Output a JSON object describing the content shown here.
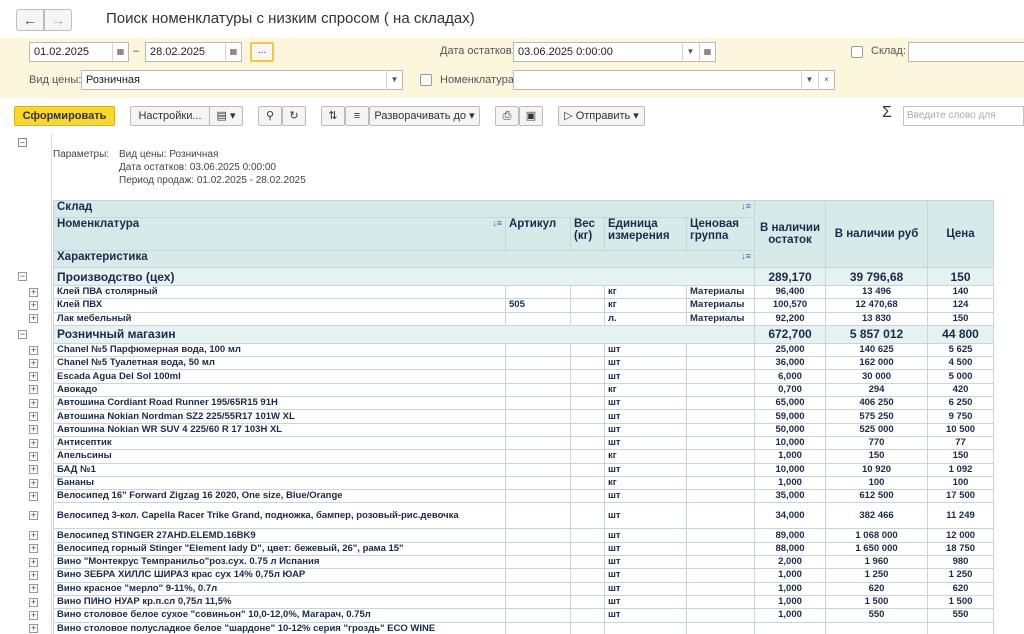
{
  "window": {
    "title": "Поиск номенклатуры с низким спросом ( на складах)"
  },
  "filters": {
    "date_from": "01.02.2025",
    "date_to": "28.02.2025",
    "dash": "–",
    "dots": "...",
    "stock_date_label": "Дата остатков:",
    "stock_date_value": "03.06.2025  0:00:00",
    "warehouse_label": "Склад:",
    "price_type_label": "Вид цены:",
    "price_type_value": "Розничная",
    "nomenclature_label": "Номенклатура:"
  },
  "toolbar": {
    "generate": "Сформировать",
    "settings": "Настройки...",
    "expand": "Разворачивать до",
    "send": "Отправить",
    "sigma": "Σ",
    "search_placeholder": "Введите слово для"
  },
  "params": {
    "label": "Параметры:",
    "line1": "Вид цены: Розничная",
    "line2": "Дата остатков: 03.06.2025 0:00:00",
    "line3": "Период продаж: 01.02.2025 - 28.02.2025"
  },
  "table": {
    "headers": {
      "warehouse": "Склад",
      "nomenclature": "Номенклатура",
      "article": "Артикул",
      "weight": "Вес (кг)",
      "unit": "Единица измерения",
      "price_group": "Ценовая группа",
      "stock_qty": "В наличии остаток",
      "stock_rub": "В наличии руб",
      "price": "Цена",
      "characteristic": "Характеристика"
    },
    "groups": [
      {
        "name": "Производство (цех)",
        "qty": "289,170",
        "rub": "39 796,68",
        "price": "150",
        "rows": [
          {
            "name": "Клей ПВА столярный",
            "article": "",
            "unit": "кг",
            "group": "Материалы",
            "qty": "96,400",
            "rub": "13 496",
            "price": "140"
          },
          {
            "name": "Клей ПВХ",
            "article": "505",
            "unit": "кг",
            "group": "Материалы",
            "qty": "100,570",
            "rub": "12 470,68",
            "price": "124"
          },
          {
            "name": "Лак мебельный",
            "article": "",
            "unit": "л.",
            "group": "Материалы",
            "qty": "92,200",
            "rub": "13 830",
            "price": "150"
          }
        ]
      },
      {
        "name": "Розничный магазин",
        "qty": "672,700",
        "rub": "5 857 012",
        "price": "44 800",
        "rows": [
          {
            "name": "Chanel №5 Парфюмерная вода, 100 мл",
            "article": "",
            "unit": "шт",
            "group": "",
            "qty": "25,000",
            "rub": "140 625",
            "price": "5 625"
          },
          {
            "name": "Chanel №5 Туалетная вода, 50 мл",
            "article": "",
            "unit": "шт",
            "group": "",
            "qty": "36,000",
            "rub": "162 000",
            "price": "4 500"
          },
          {
            "name": "Escada Agua Del Sol 100ml",
            "article": "",
            "unit": "шт",
            "group": "",
            "qty": "6,000",
            "rub": "30 000",
            "price": "5 000"
          },
          {
            "name": "Авокадо",
            "article": "",
            "unit": "кг",
            "group": "",
            "qty": "0,700",
            "rub": "294",
            "price": "420"
          },
          {
            "name": "Автошина Cordiant Road Runner 195/65R15 91H",
            "article": "",
            "unit": "шт",
            "group": "",
            "qty": "65,000",
            "rub": "406 250",
            "price": "6 250"
          },
          {
            "name": "Автошина Nokian Nordman SZ2 225/55R17 101W XL",
            "article": "",
            "unit": "шт",
            "group": "",
            "qty": "59,000",
            "rub": "575 250",
            "price": "9 750"
          },
          {
            "name": "Автошина Nokian WR SUV 4 225/60 R 17 103H XL",
            "article": "",
            "unit": "шт",
            "group": "",
            "qty": "50,000",
            "rub": "525 000",
            "price": "10 500"
          },
          {
            "name": "Антисептик",
            "article": "",
            "unit": "шт",
            "group": "",
            "qty": "10,000",
            "rub": "770",
            "price": "77"
          },
          {
            "name": "Апельсины",
            "article": "",
            "unit": "кг",
            "group": "",
            "qty": "1,000",
            "rub": "150",
            "price": "150"
          },
          {
            "name": "БАД №1",
            "article": "",
            "unit": "шт",
            "group": "",
            "qty": "10,000",
            "rub": "10 920",
            "price": "1 092"
          },
          {
            "name": "Бананы",
            "article": "",
            "unit": "кг",
            "group": "",
            "qty": "1,000",
            "rub": "100",
            "price": "100"
          },
          {
            "name": "Велосипед 16\" Forward Zigzag 16 2020, One size, Blue/Orange",
            "article": "",
            "unit": "шт",
            "group": "",
            "qty": "35,000",
            "rub": "612 500",
            "price": "17 500"
          },
          {
            "name": "Велосипед 3-кол. Capella Racer Trike Grand, подножка, бампер, розовый-рис.девочка",
            "article": "",
            "unit": "шт",
            "group": "",
            "qty": "34,000",
            "rub": "382 466",
            "price": "11 249",
            "tall": true
          },
          {
            "name": "Велосипед STINGER 27AHD.ELEMD.16BK9",
            "article": "",
            "unit": "шт",
            "group": "",
            "qty": "89,000",
            "rub": "1 068 000",
            "price": "12 000"
          },
          {
            "name": "Велосипед горный Stinger \"Element lady D\", цвет: бежевый, 26\", рама 15\"",
            "article": "",
            "unit": "шт",
            "group": "",
            "qty": "88,000",
            "rub": "1 650 000",
            "price": "18 750"
          },
          {
            "name": "Вино \"Монтекрус Темпранильо\"роз.сух. 0.75 л Испания",
            "article": "",
            "unit": "шт",
            "group": "",
            "qty": "2,000",
            "rub": "1 960",
            "price": "980"
          },
          {
            "name": "Вино ЗЕБРА ХИЛЛС ШИРАЗ крас сух 14% 0,75л ЮАР",
            "article": "",
            "unit": "шт",
            "group": "",
            "qty": "1,000",
            "rub": "1 250",
            "price": "1 250"
          },
          {
            "name": "Вино красное \"мерло\" 9-11%, 0.7л",
            "article": "",
            "unit": "шт",
            "group": "",
            "qty": "1,000",
            "rub": "620",
            "price": "620"
          },
          {
            "name": "Вино ПИНО НУАР кр.п.сл 0,75л 11,5%",
            "article": "",
            "unit": "шт",
            "group": "",
            "qty": "1,000",
            "rub": "1 500",
            "price": "1 500"
          },
          {
            "name": "Вино столовое белое сухое \"совиньон\" 10,0-12,0%, Магарач, 0.75л",
            "article": "",
            "unit": "шт",
            "group": "",
            "qty": "1,000",
            "rub": "550",
            "price": "550"
          },
          {
            "name": "Вино столовое полусладкое белое \"шардоне\" 10-12% серия \"гроздь\" ECO WINE",
            "article": "",
            "unit": "",
            "group": "",
            "qty": "",
            "rub": "",
            "price": ""
          }
        ]
      }
    ]
  }
}
